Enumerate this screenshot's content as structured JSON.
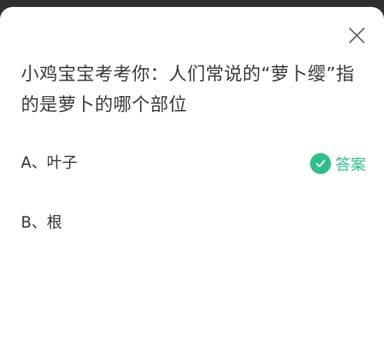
{
  "question": {
    "line1": "小鸡宝宝考考你：人们常说的“萝卜缨”指",
    "line2": "的是萝卜的哪个部位"
  },
  "options": [
    {
      "label": "A、叶子"
    },
    {
      "label": "B、根"
    }
  ],
  "answer_tag": {
    "label": "答案",
    "color": "#2fbf86"
  },
  "icons": {
    "close": "close-icon",
    "check": "check-circle-icon"
  }
}
